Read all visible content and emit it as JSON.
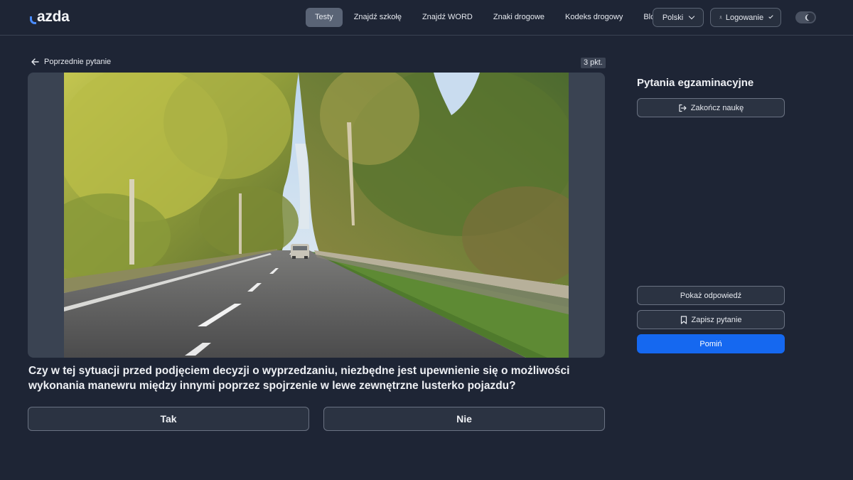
{
  "brand": {
    "logo_text": "azda"
  },
  "nav": {
    "items": [
      {
        "label": "Testy",
        "active": true
      },
      {
        "label": "Znajdź szkołę",
        "active": false
      },
      {
        "label": "Znajdź WORD",
        "active": false
      },
      {
        "label": "Znaki drogowe",
        "active": false
      },
      {
        "label": "Kodeks drogowy",
        "active": false
      },
      {
        "label": "Blog",
        "active": false
      }
    ],
    "language": "Polski",
    "login": "Logowanie",
    "theme_toggle_icon": "moon-icon"
  },
  "question_panel": {
    "back_label": "Poprzednie pytanie",
    "points": "3 pkt.",
    "question_text": "Czy w tej sytuacji przed podjęciem decyzji o wyprzedzaniu, niezbędne jest upewnienie się o możliwości wykonania manewru między innymi poprzez spojrzenie w lewe zewnętrzne lusterko pojazdu?",
    "answers": {
      "yes": "Tak",
      "no": "Nie"
    }
  },
  "sidebar": {
    "title": "Pytania egzaminacyjne",
    "end_label": "Zakończ naukę",
    "show_answer_label": "Pokaż odpowiedź",
    "save_label": "Zapisz pytanie",
    "skip_label": "Pomiń"
  },
  "colors": {
    "background": "#1e2535",
    "accent": "#1568f0",
    "logo_accent": "#4a8cff"
  }
}
